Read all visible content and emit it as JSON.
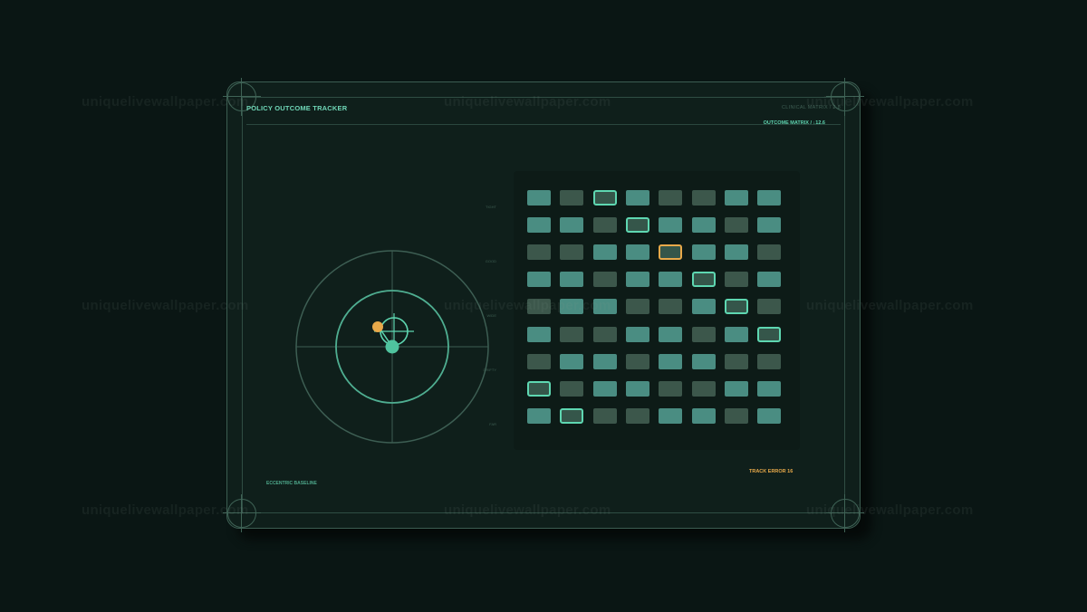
{
  "panel": {
    "title": "POLICY OUTCOME TRACKER",
    "meta": "CLINICAL MATRIX / 2.8",
    "submeta": "OUTCOME MATRIX / ↓12.6",
    "baseline_label": "ECCENTRIC BASELINE",
    "track_error": "TRACK ERROR 16"
  },
  "matrix": {
    "row_labels": [
      "TIGHT",
      "GOOD",
      "WIDE",
      "DRIFTY",
      "FAR"
    ],
    "rows": [
      [
        "teal",
        "dim",
        "hl",
        "teal",
        "dim",
        "dim",
        "teal",
        "teal"
      ],
      [
        "teal",
        "teal",
        "dim",
        "hl",
        "teal",
        "teal",
        "dim",
        "teal"
      ],
      [
        "dim",
        "dim",
        "teal",
        "teal",
        "warn",
        "teal",
        "teal",
        "dim"
      ],
      [
        "teal",
        "teal",
        "dim",
        "teal",
        "teal",
        "hl",
        "dim",
        "teal"
      ],
      [
        "dim",
        "teal",
        "teal",
        "dim",
        "dim",
        "teal",
        "hl",
        "dim"
      ],
      [
        "teal",
        "dim",
        "dim",
        "teal",
        "teal",
        "dim",
        "teal",
        "hl"
      ],
      [
        "dim",
        "teal",
        "teal",
        "dim",
        "teal",
        "teal",
        "dim",
        "dim"
      ],
      [
        "hl",
        "dim",
        "teal",
        "teal",
        "dim",
        "dim",
        "teal",
        "teal"
      ],
      [
        "teal",
        "hl",
        "dim",
        "dim",
        "teal",
        "teal",
        "dim",
        "teal"
      ]
    ]
  },
  "colors": {
    "accent": "#5ed7b1",
    "teal_cell": "#4a8d82",
    "dim_cell": "#3c574b",
    "warning": "#e8a94a",
    "background": "#0a1614",
    "panel": "#0f1f1b"
  },
  "watermark": "uniquelivewallpaper.com"
}
